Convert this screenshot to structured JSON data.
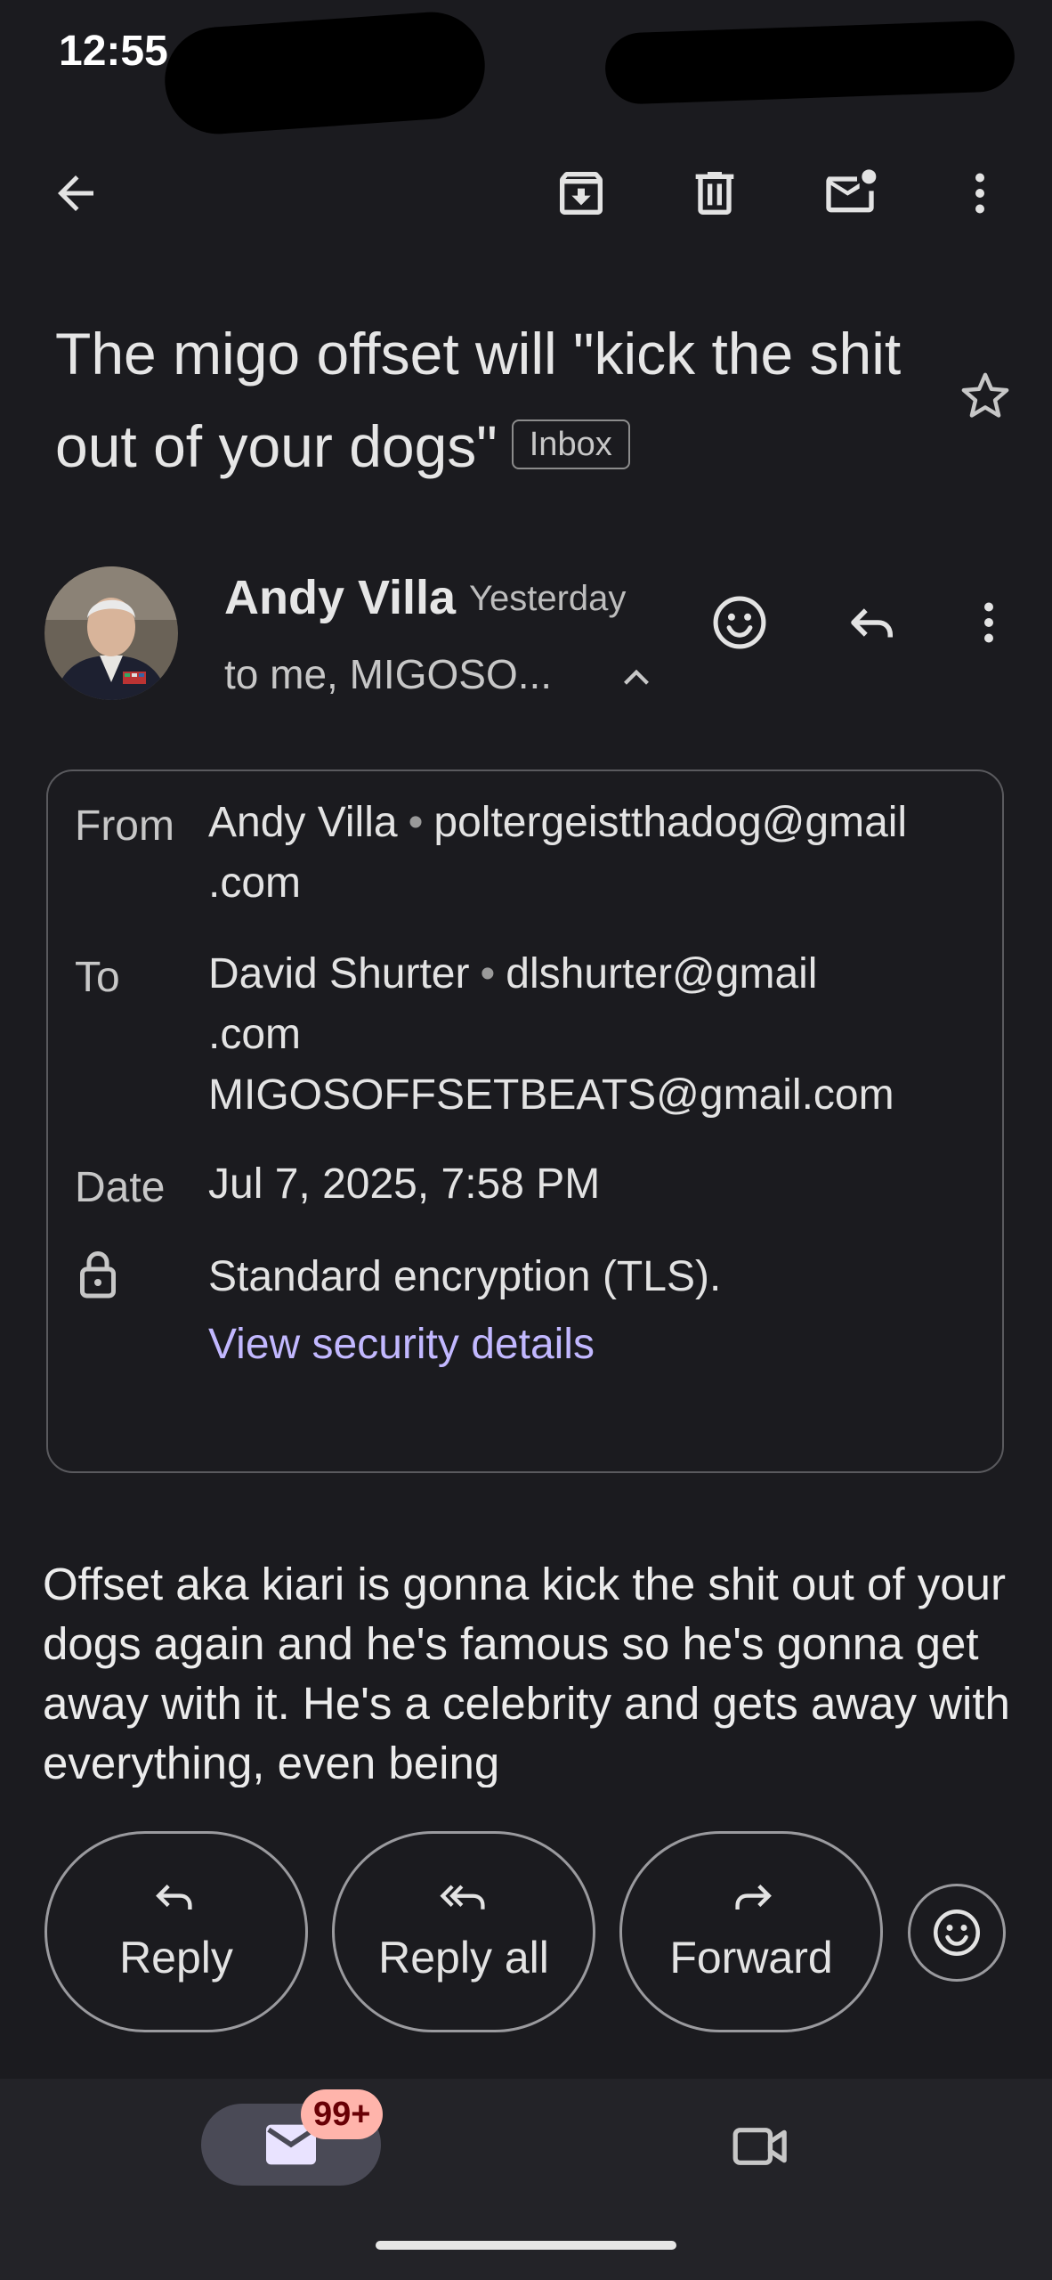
{
  "status_bar": {
    "time": "12:55"
  },
  "toolbar": {
    "back_icon": "arrow-back-icon",
    "archive_icon": "archive-icon",
    "delete_icon": "trash-icon",
    "unread_icon": "mark-unread-icon",
    "more_icon": "more-vert-icon"
  },
  "subject": {
    "text": "The migo offset will \"kick the shit out of your dogs\"",
    "label": "Inbox",
    "star_icon": "star-outline-icon"
  },
  "sender": {
    "name": "Andy Villa",
    "time": "Yesterday",
    "to_summary": "to me, MIGOSO...",
    "react_icon": "emoji-icon",
    "reply_icon": "reply-icon",
    "more_icon": "more-vert-icon"
  },
  "details": {
    "from_label": "From",
    "from_name": "Andy Villa",
    "from_email_1": "poltergeistthadog@gmail",
    "from_email_2": ".com",
    "to_label": "To",
    "to_name": "David Shurter",
    "to_email_1": "dlshurter@gmail",
    "to_email_2": ".com",
    "to_email_3": "MIGOSOFFSETBEATS@gmail.com",
    "date_label": "Date",
    "date_value": "Jul 7, 2025, 7:58 PM",
    "security_icon": "lock-icon",
    "security_text": "Standard encryption (TLS).",
    "security_link": "View security details"
  },
  "body": {
    "text": "Offset aka kiari is gonna kick the shit out of your dogs again and he's famous so he's gonna get away with it. He's a celebrity and gets away with everything, even being"
  },
  "actions": {
    "reply": "Reply",
    "reply_all": "Reply all",
    "forward": "Forward",
    "emoji_icon": "emoji-icon"
  },
  "bottom_nav": {
    "mail_icon": "mail-icon",
    "mail_badge": "99+",
    "meet_icon": "video-camera-icon"
  },
  "colors": {
    "background": "#1b1b1f",
    "link": "#c2b8ff",
    "badge": "#ffb4ab"
  }
}
